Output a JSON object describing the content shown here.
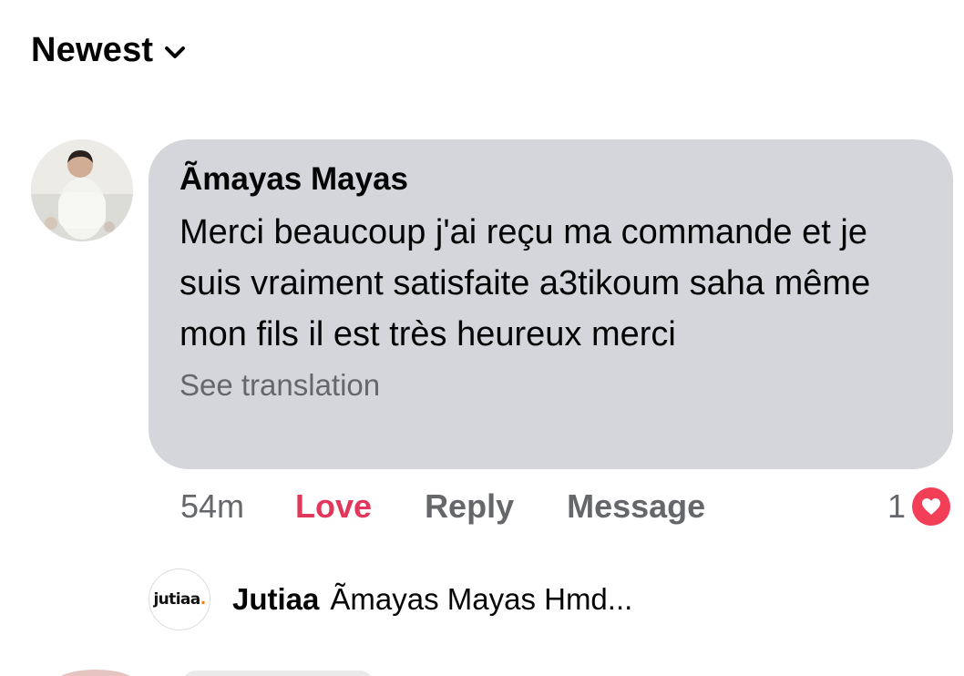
{
  "sort": {
    "label": "Newest",
    "icon": "chevron-down-icon"
  },
  "comment": {
    "author": "Ãmayas Mayas",
    "text": "Merci beaucoup j'ai reçu ma commande et je suis vraiment satisfaite a3tikoum saha même mon fils il est très heureux merci",
    "see_translation": "See translation",
    "timestamp": "54m",
    "actions": {
      "love": "Love",
      "reply": "Reply",
      "message": "Message"
    },
    "reaction_count": "1",
    "reaction_icon": "love-reaction-icon",
    "colors": {
      "bubble": "#d4d6db",
      "love": "#e0375a",
      "reaction": "#f33e58"
    }
  },
  "reply_preview": {
    "avatar_text": "jutiaa",
    "name": "Jutiaa",
    "snippet": "Ãmayas Mayas Hmd..."
  }
}
